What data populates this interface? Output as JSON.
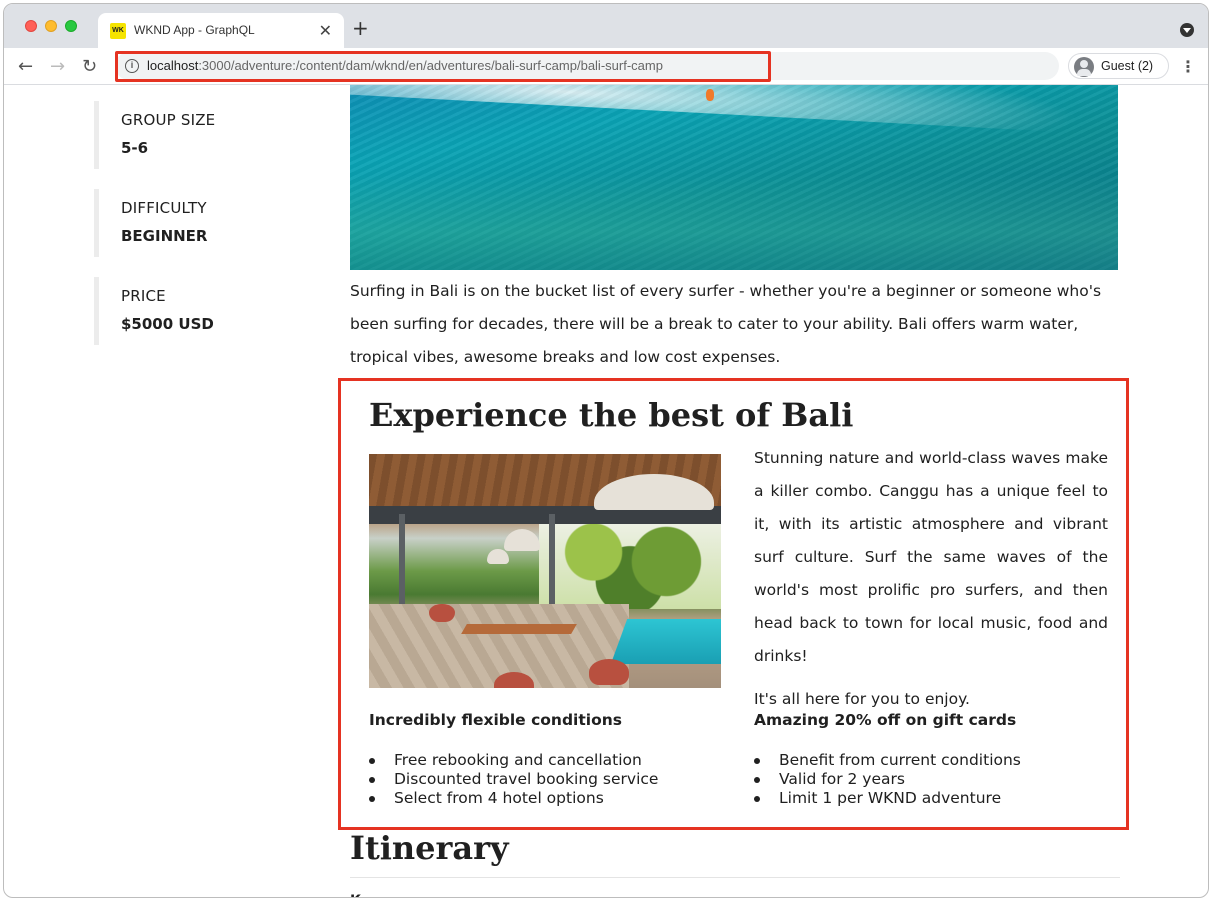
{
  "browser": {
    "tab_title": "WKND App - GraphQL",
    "tab_favicon_text": "WK",
    "url_host": "localhost",
    "url_path": ":3000/adventure:/content/dam/wknd/en/adventures/bali-surf-camp/bali-surf-camp",
    "profile_label": "Guest (2)",
    "accent_highlight": "#e53322"
  },
  "stats": [
    {
      "label": "GROUP SIZE",
      "value": "5-6"
    },
    {
      "label": "DIFFICULTY",
      "value": "BEGINNER"
    },
    {
      "label": "PRICE",
      "value": "$5000 USD"
    }
  ],
  "intro_text": "Surfing in Bali is on the bucket list of every surfer - whether you're a beginner or someone who's been surfing for decades, there will be a break to cater to your ability. Bali offers warm water, tropical vibes, awesome breaks and low cost expenses.",
  "feature": {
    "title": "Experience the best of Bali",
    "paragraph1": "Stunning nature and world-class waves make a killer combo. Canggu has a unique feel to it, with its artistic atmosphere and vibrant surf culture.  Surf the same waves of the world's most prolific pro surfers, and then head back to town for local music, food and drinks!",
    "paragraph2": "It's all here for you to enjoy.",
    "left_heading": "Incredibly flexible conditions",
    "left_items": [
      "Free rebooking and cancellation",
      "Discounted travel booking service",
      "Select from 4 hotel options"
    ],
    "right_heading": "Amazing 20% off on gift cards",
    "right_items": [
      "Benefit from current conditions",
      "Valid for 2 years",
      "Limit 1 per WKND adventure"
    ]
  },
  "itinerary": {
    "title": "Itinerary",
    "next_text": "K"
  }
}
